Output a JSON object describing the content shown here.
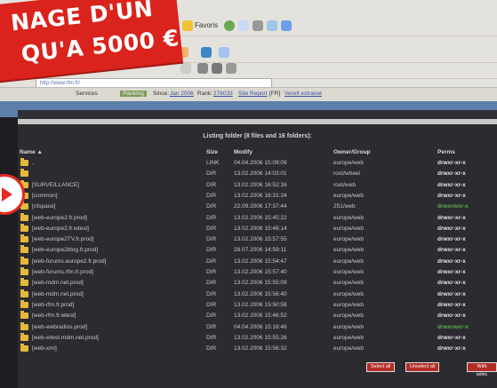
{
  "banner": {
    "line1": "NAGE D'UN",
    "line2": "QU'A 5000 €"
  },
  "toolbar": {
    "favorites": "Favoris"
  },
  "address": {
    "url": "http://www.rfm.fr/"
  },
  "info_bar": {
    "services_label": "Services",
    "badge": "Ranking",
    "since_label": "Since:",
    "since_value": "Jan 2006",
    "rank_label": "Rank:",
    "rank_value": "276033",
    "report_link": "Site Report",
    "lang": "[FR]",
    "extra_link": "Verelt extranet"
  },
  "listing": {
    "title": "Listing folder (8 files and 16 folders):",
    "headers": {
      "name": "Name ▲",
      "size": "Size",
      "modify": "Modify",
      "owner": "Owner/Group",
      "perms": "Perms"
    },
    "rows": [
      {
        "name": "..",
        "size": "LINK",
        "modify": "04.04.2006 15:09:09",
        "owner": "europe/web",
        "perms": "drwxr-xr-x",
        "green": false
      },
      {
        "name": "",
        "size": "DIR",
        "modify": "13.02.2006 14:03:01",
        "owner": "root/wheel",
        "perms": "drwxr-xr-x",
        "green": false
      },
      {
        "name": "[SURVEILLANCE]",
        "size": "DIR",
        "modify": "13.02.2006 16:52:16",
        "owner": "root/web",
        "perms": "drwxr-xr-x",
        "green": false
      },
      {
        "name": "[common]",
        "size": "DIR",
        "modify": "13.02.2006 16:31:34",
        "owner": "europe/web",
        "perms": "drwxr-xr-x",
        "green": false
      },
      {
        "name": "[nfspace]",
        "size": "DIR",
        "modify": "22.09.2006 17:37:44",
        "owner": "251/web",
        "perms": "drwxrwxr-x",
        "green": true
      },
      {
        "name": "[web-europe2.fr.prod]",
        "size": "DIR",
        "modify": "13.02.2006 15:45:22",
        "owner": "europe/web",
        "perms": "drwxr-xr-x",
        "green": false
      },
      {
        "name": "[web-europe2.fr.wtest]",
        "size": "DIR",
        "modify": "13.02.2006 15:46:14",
        "owner": "europe/web",
        "perms": "drwxr-xr-x",
        "green": false
      },
      {
        "name": "[web-europe2TV.fr.prod]",
        "size": "DIR",
        "modify": "13.02.2006 15:57:55",
        "owner": "europe/web",
        "perms": "drwxr-xr-x",
        "green": false
      },
      {
        "name": "[web-europe2blog.fr.prod]",
        "size": "DIR",
        "modify": "28.07.2006 14:59:11",
        "owner": "europe/web",
        "perms": "drwxr-xr-x",
        "green": false
      },
      {
        "name": "[web-forums.europe2.fr.prod]",
        "size": "DIR",
        "modify": "13.02.2006 15:54:47",
        "owner": "europe/web",
        "perms": "drwxr-xr-x",
        "green": false
      },
      {
        "name": "[web-forums.rfm.fr.prod]",
        "size": "DIR",
        "modify": "13.02.2006 15:57:40",
        "owner": "europe/web",
        "perms": "drwxr-xr-x",
        "green": false
      },
      {
        "name": "[web-mdm.net.prod]",
        "size": "DIR",
        "modify": "13.02.2006 15:55:09",
        "owner": "europe/web",
        "perms": "drwxr-xr-x",
        "green": false
      },
      {
        "name": "[web-mdm.net.prod]",
        "size": "DIR",
        "modify": "13.02.2006 15:56:40",
        "owner": "europe/web",
        "perms": "drwxr-xr-x",
        "green": false
      },
      {
        "name": "[web-rfm.fr.prod]",
        "size": "DIR",
        "modify": "13.02.2006 15:50:58",
        "owner": "europe/web",
        "perms": "drwxr-xr-x",
        "green": false
      },
      {
        "name": "[web-rfm.fr.wtest]",
        "size": "DIR",
        "modify": "13.02.2006 15:46:52",
        "owner": "europe/web",
        "perms": "drwxr-xr-x",
        "green": false
      },
      {
        "name": "[web-webradios.prod]",
        "size": "DIR",
        "modify": "04.04.2006 15:16:46",
        "owner": "europe/web",
        "perms": "drwxrwxr-x",
        "green": true
      },
      {
        "name": "[web-wtest.mdm.net.prod]",
        "size": "DIR",
        "modify": "13.02.2006 15:55:26",
        "owner": "europe/web",
        "perms": "drwxr-xr-x",
        "green": false
      },
      {
        "name": "[web-xml]",
        "size": "DIR",
        "modify": "13.02.2006 15:56:32",
        "owner": "europe/web",
        "perms": "drwxr-xr-x",
        "green": false
      }
    ],
    "buttons": {
      "select_all": "Select all",
      "unselect_all": "Unselect all",
      "action": "With selec"
    }
  },
  "colors": {
    "banner_red": "#d9231c",
    "listing_bg": "#2b2b30",
    "folder_yellow": "#e6b93a",
    "perm_green": "#5fae4c"
  }
}
